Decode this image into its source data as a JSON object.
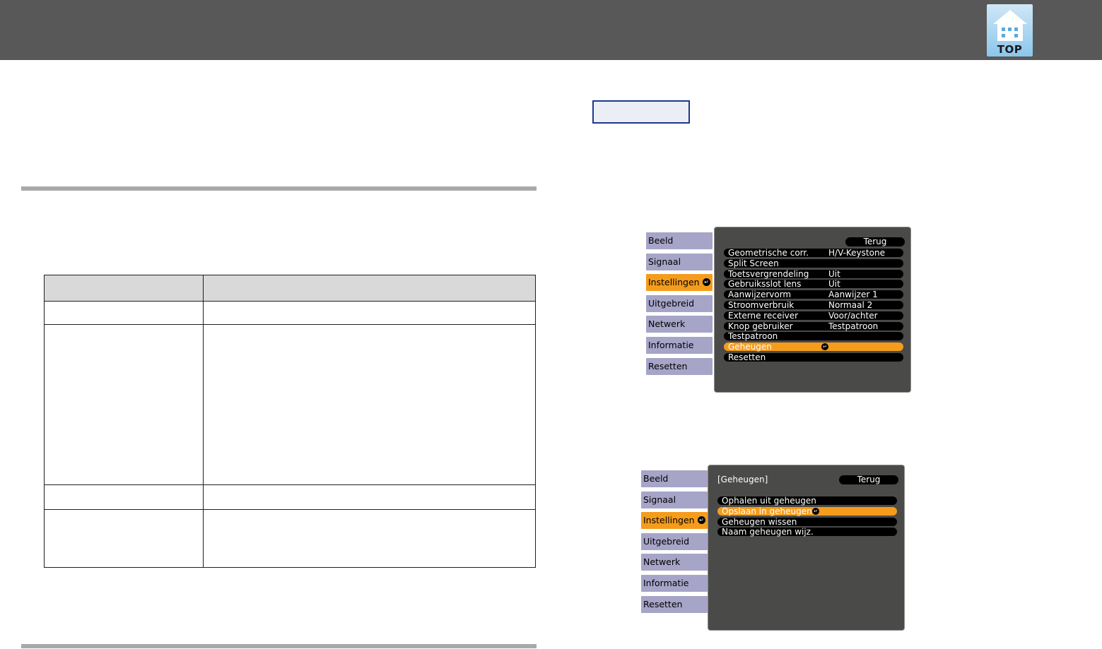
{
  "header": {
    "logo_text": "TOP"
  },
  "menu1": {
    "tabs": [
      {
        "label": "Beeld",
        "active": false
      },
      {
        "label": "Signaal",
        "active": false
      },
      {
        "label": "Instellingen",
        "active": true
      },
      {
        "label": "Uitgebreid",
        "active": false
      },
      {
        "label": "Netwerk",
        "active": false
      },
      {
        "label": "Informatie",
        "active": false
      },
      {
        "label": "Resetten",
        "active": false
      }
    ],
    "back_label": "Terug",
    "items": [
      {
        "label": "Geometrische corr.",
        "value": "H/V-Keystone"
      },
      {
        "label": "Split Screen",
        "value": ""
      },
      {
        "label": "Toetsvergrendeling",
        "value": "Uit"
      },
      {
        "label": "Gebruiksslot lens",
        "value": "Uit"
      },
      {
        "label": "Aanwijzervorm",
        "value": "Aanwijzer 1"
      },
      {
        "label": "Stroomverbruik",
        "value": "Normaal 2"
      },
      {
        "label": "Externe receiver",
        "value": "Voor/achter"
      },
      {
        "label": "Knop gebruiker",
        "value": "Testpatroon"
      },
      {
        "label": "Testpatroon",
        "value": ""
      },
      {
        "label": "Geheugen",
        "value": "",
        "selected": true
      },
      {
        "label": "Resetten",
        "value": ""
      }
    ]
  },
  "menu2": {
    "tabs": [
      {
        "label": "Beeld",
        "active": false
      },
      {
        "label": "Signaal",
        "active": false
      },
      {
        "label": "Instellingen",
        "active": true
      },
      {
        "label": "Uitgebreid",
        "active": false
      },
      {
        "label": "Netwerk",
        "active": false
      },
      {
        "label": "Informatie",
        "active": false
      },
      {
        "label": "Resetten",
        "active": false
      }
    ],
    "title": "[Geheugen]",
    "back_label": "Terug",
    "items": [
      {
        "label": "Ophalen uit geheugen",
        "selected": false
      },
      {
        "label": "Opslaan in geheugen",
        "selected": true
      },
      {
        "label": "Geheugen wissen",
        "selected": false
      },
      {
        "label": "Naam geheugen wijz.",
        "selected": false
      }
    ]
  },
  "colors": {
    "header_bg": "#585858",
    "tab_bg": "#a6a4c7",
    "tab_active": "#f59c1c",
    "panel_bg": "#4a4a48",
    "rule": "#a9a9a9"
  }
}
